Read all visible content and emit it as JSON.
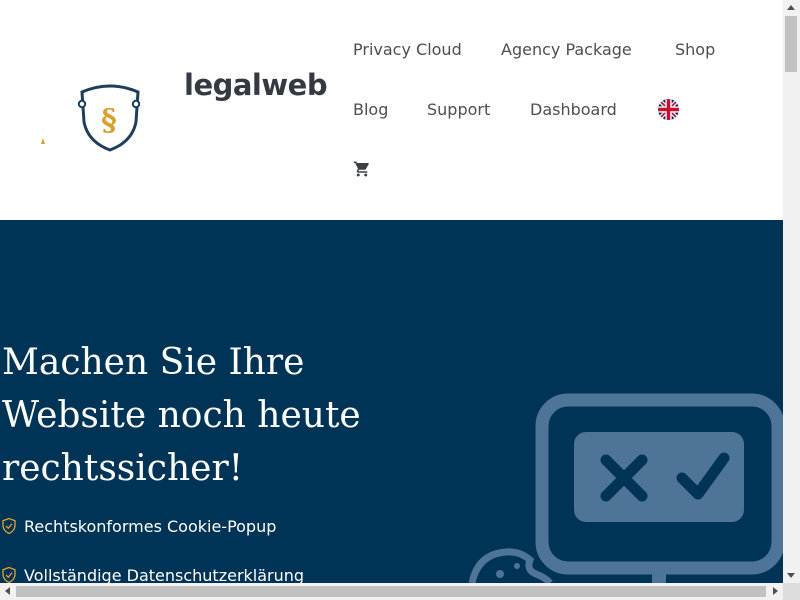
{
  "brand": {
    "name": "legalweb",
    "logo_symbol": "§",
    "colors": {
      "navy": "#003457",
      "gold": "#d9a030",
      "text": "#333a41"
    }
  },
  "nav": {
    "items": [
      {
        "label": "Privacy Cloud"
      },
      {
        "label": "Agency Package"
      },
      {
        "label": "Shop"
      },
      {
        "label": "Blog"
      },
      {
        "label": "Support"
      },
      {
        "label": "Dashboard"
      }
    ],
    "language_icon": "uk-flag-icon",
    "cart_icon": "cart-icon"
  },
  "hero": {
    "title": "Machen Sie Ihre Website noch heute rechtssicher!",
    "features": [
      {
        "label": "Rechtskonformes Cookie-Popup",
        "icon": "shield-check-icon"
      },
      {
        "label": "Vollständige Datenschutzerklärung",
        "icon": "shield-check-icon"
      }
    ],
    "illustration": "consent-monitor-icon",
    "background": "#003457"
  }
}
